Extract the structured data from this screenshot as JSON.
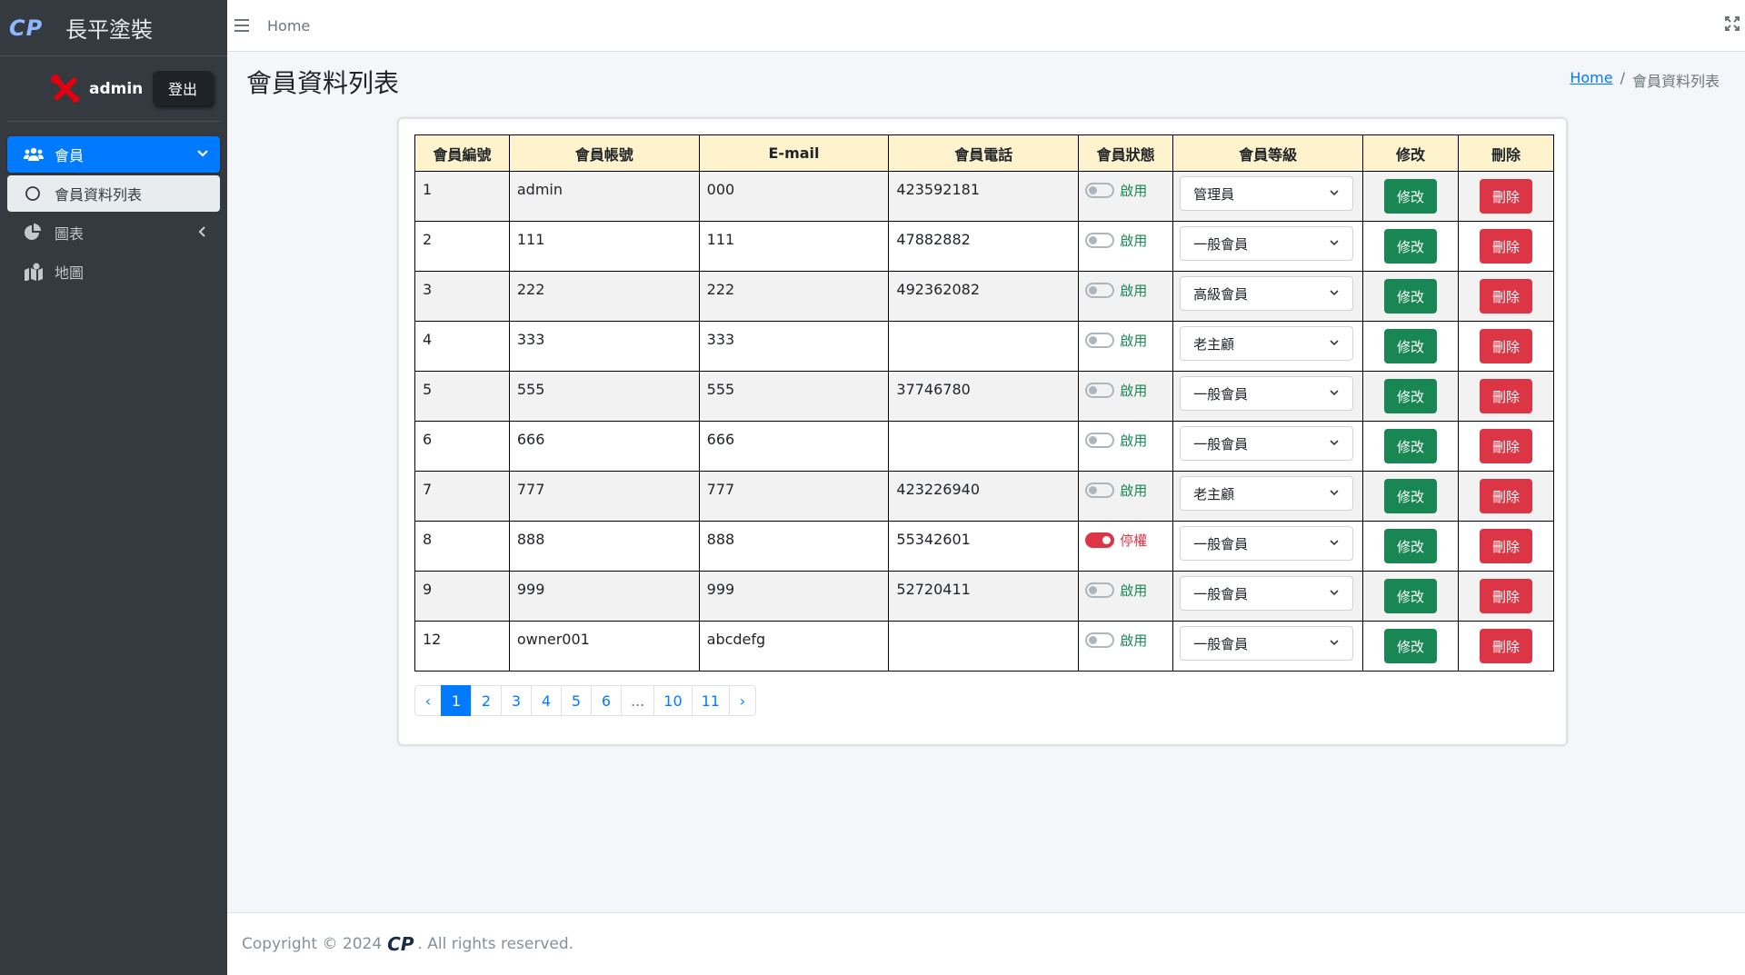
{
  "brand": {
    "logo": "CP",
    "name": "長平塗裝"
  },
  "user": {
    "name": "admin",
    "logout_label": "登出"
  },
  "sidebar": {
    "items": [
      {
        "label": "會員"
      },
      {
        "label": "會員資料列表"
      },
      {
        "label": "圖表"
      },
      {
        "label": "地圖"
      }
    ]
  },
  "topbar": {
    "home_label": "Home"
  },
  "content": {
    "title": "會員資料列表",
    "breadcrumb": {
      "home": "Home",
      "separator": "/",
      "current": "會員資料列表"
    }
  },
  "table": {
    "headers": [
      "會員編號",
      "會員帳號",
      "E-mail",
      "會員電話",
      "會員狀態",
      "會員等級",
      "修改",
      "刪除"
    ],
    "edit_label": "修改",
    "delete_label": "刪除",
    "rows": [
      {
        "id": "1",
        "account": "admin",
        "email": "000",
        "phone": "423592181",
        "status": "啟用",
        "level": "管理員"
      },
      {
        "id": "2",
        "account": "111",
        "email": "111",
        "phone": "47882882",
        "status": "啟用",
        "level": "一般會員"
      },
      {
        "id": "3",
        "account": "222",
        "email": "222",
        "phone": "492362082",
        "status": "啟用",
        "level": "高級會員"
      },
      {
        "id": "4",
        "account": "333",
        "email": "333",
        "phone": "",
        "status": "啟用",
        "level": "老主顧"
      },
      {
        "id": "5",
        "account": "555",
        "email": "555",
        "phone": "37746780",
        "status": "啟用",
        "level": "一般會員"
      },
      {
        "id": "6",
        "account": "666",
        "email": "666",
        "phone": "",
        "status": "啟用",
        "level": "一般會員"
      },
      {
        "id": "7",
        "account": "777",
        "email": "777",
        "phone": "423226940",
        "status": "啟用",
        "level": "老主顧"
      },
      {
        "id": "8",
        "account": "888",
        "email": "888",
        "phone": "55342601",
        "status": "停權",
        "level": "一般會員"
      },
      {
        "id": "9",
        "account": "999",
        "email": "999",
        "phone": "52720411",
        "status": "啟用",
        "level": "一般會員"
      },
      {
        "id": "12",
        "account": "owner001",
        "email": "abcdefg",
        "phone": "",
        "status": "啟用",
        "level": "一般會員"
      }
    ]
  },
  "pagination": {
    "prev": "‹",
    "pages": [
      "1",
      "2",
      "3",
      "4",
      "5",
      "6",
      "...",
      "10",
      "11"
    ],
    "next": "›",
    "current": "1"
  },
  "footer": {
    "prefix": "Copyright © 2024",
    "logo": "CP",
    "suffix": ". All rights reserved."
  },
  "colors": {
    "sidebar_bg": "#343a40",
    "primary": "#007bff",
    "edit_green": "#198754",
    "delete_red": "#dc3545",
    "table_header": "#fff3cd"
  }
}
